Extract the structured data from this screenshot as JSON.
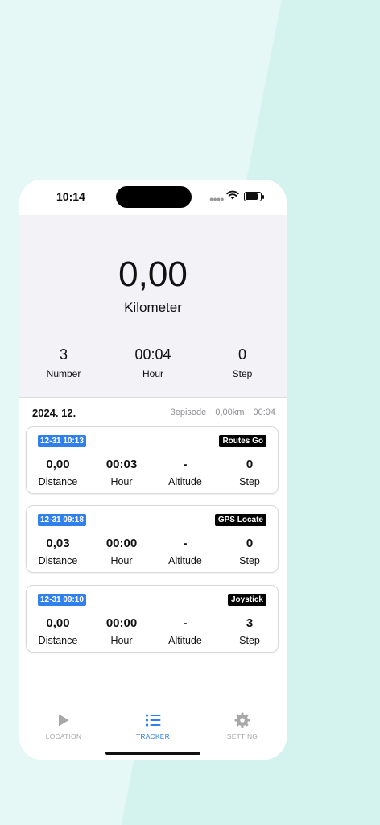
{
  "status": {
    "time": "10:14"
  },
  "summary": {
    "distance_value": "0,00",
    "distance_unit": "Kilometer",
    "stats": [
      {
        "value": "3",
        "label": "Number"
      },
      {
        "value": "00:04",
        "label": "Hour"
      },
      {
        "value": "0",
        "label": "Step"
      }
    ]
  },
  "month": {
    "title": "2024. 12.",
    "episodes": "3episode",
    "distance": "0,00km",
    "duration": "00:04"
  },
  "records": [
    {
      "date": "12-31 10:13",
      "mode": "Routes Go",
      "distance": "0,00",
      "hour": "00:03",
      "altitude": "-",
      "step": "0",
      "labels": {
        "distance": "Distance",
        "hour": "Hour",
        "altitude": "Altitude",
        "step": "Step"
      }
    },
    {
      "date": "12-31 09:18",
      "mode": "GPS Locate",
      "distance": "0,03",
      "hour": "00:00",
      "altitude": "-",
      "step": "0",
      "labels": {
        "distance": "Distance",
        "hour": "Hour",
        "altitude": "Altitude",
        "step": "Step"
      }
    },
    {
      "date": "12-31 09:10",
      "mode": "Joystick",
      "distance": "0,00",
      "hour": "00:00",
      "altitude": "-",
      "step": "3",
      "labels": {
        "distance": "Distance",
        "hour": "Hour",
        "altitude": "Altitude",
        "step": "Step"
      }
    }
  ],
  "tabs": [
    {
      "label": "LOCATION",
      "icon": "play-icon",
      "active": false
    },
    {
      "label": "TRACKER",
      "icon": "list-icon",
      "active": true
    },
    {
      "label": "SETTING",
      "icon": "gear-icon",
      "active": false
    }
  ],
  "colors": {
    "accent": "#2f80ed",
    "inactive_tab": "#a8a8a8",
    "summary_bg": "#f2f2f7"
  }
}
